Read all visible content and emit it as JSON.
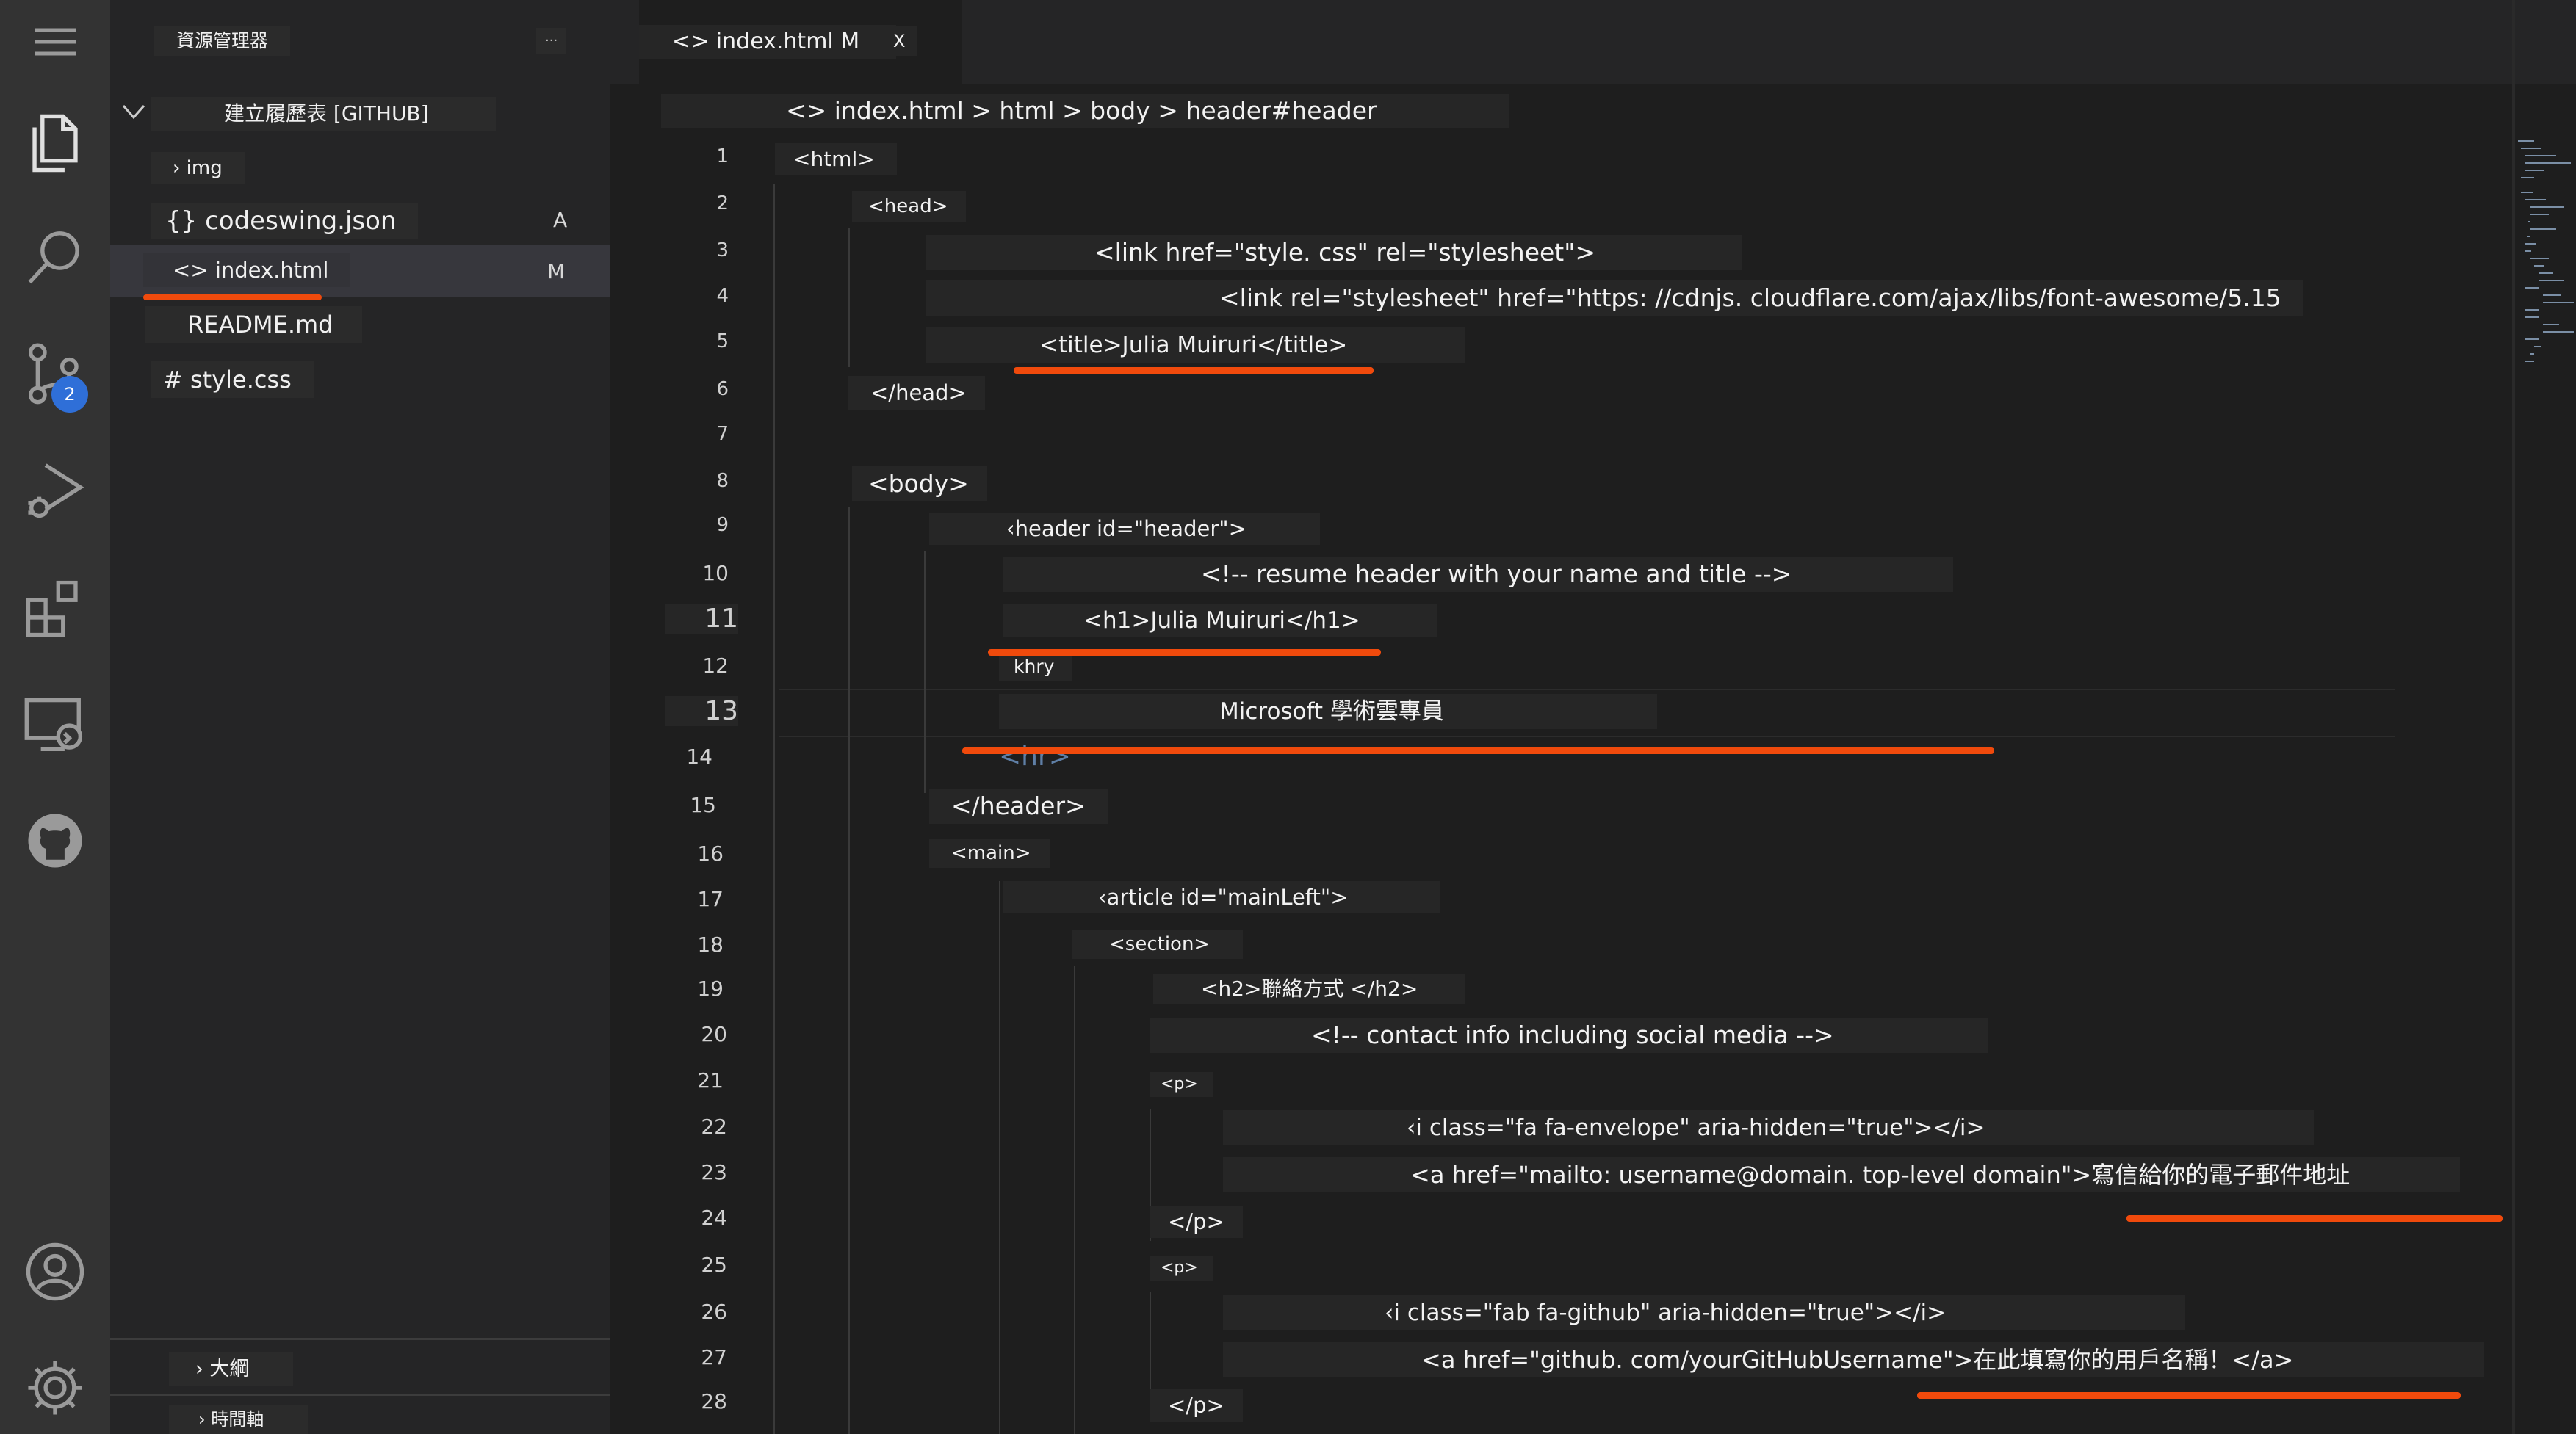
{
  "activity_bar": {
    "icons": [
      "menu-icon",
      "explorer-icon",
      "search-icon",
      "source-control-icon",
      "run-debug-icon",
      "extensions-icon",
      "remote-explorer-icon",
      "github-icon",
      "account-icon",
      "settings-gear-icon"
    ],
    "source_control_badge": "2"
  },
  "sidebar": {
    "title": "資源管理器",
    "more_actions": "···",
    "folder_name": "建立履歷表 [GITHUB]",
    "items": [
      {
        "label": "› img",
        "badge": ""
      },
      {
        "label": "{} codeswing.json",
        "badge": "A"
      },
      {
        "label": "<> index.html",
        "badge": "M"
      },
      {
        "label": "README.md",
        "badge": ""
      },
      {
        "label": "# style.css",
        "badge": ""
      }
    ],
    "outline_label": "› 大綱",
    "timeline_label": "› 時間軸"
  },
  "editor": {
    "tab_label": "<> index.html M",
    "tab_close": "X",
    "breadcrumb": "<> index.html > html > body > header#header",
    "lines": [
      {
        "num": "1",
        "text": "<html>"
      },
      {
        "num": "2",
        "text": "<head>"
      },
      {
        "num": "3",
        "text": "<link href=\"style. css\" rel=\"stylesheet\">"
      },
      {
        "num": "4",
        "text": "<link rel=\"stylesheet\" href=\"https: //cdnjs. cloudflare.com/ajax/libs/font-awesome/5.15"
      },
      {
        "num": "5",
        "text": "<title>Julia Muiruri</title>"
      },
      {
        "num": "6",
        "text": "</head>"
      },
      {
        "num": "7",
        "text": ""
      },
      {
        "num": "8",
        "text": "<body>"
      },
      {
        "num": "9",
        "text": "‹header id=\"header\">"
      },
      {
        "num": "10",
        "text": "<!-- resume header with your name and title -->"
      },
      {
        "num": "11",
        "text": "<h1>Julia Muiruri</h1>"
      },
      {
        "num": "12",
        "text": "khry"
      },
      {
        "num": "13",
        "text": "Microsoft 學術雲專員"
      },
      {
        "num": "14",
        "text": "<hr>"
      },
      {
        "num": "15",
        "text": "</header>"
      },
      {
        "num": "16",
        "text": "<main>"
      },
      {
        "num": "17",
        "text": "‹article id=\"mainLeft\">"
      },
      {
        "num": "18",
        "text": "<section>"
      },
      {
        "num": "19",
        "text": "<h2>聯絡方式 </h2>"
      },
      {
        "num": "20",
        "text": "<!-- contact info including social media -->"
      },
      {
        "num": "21",
        "text": "<p>"
      },
      {
        "num": "22",
        "text": "‹i class=\"fa fa-envelope\" aria-hidden=\"true\"></i>"
      },
      {
        "num": "23",
        "text": "<a href=\"mailto: username@domain. top-level domain\">寫信給你的電子郵件地址"
      },
      {
        "num": "24",
        "text": "</p>"
      },
      {
        "num": "25",
        "text": "<p>"
      },
      {
        "num": "26",
        "text": "‹i class=\"fab fa-github\" aria-hidden=\"true\"></i>"
      },
      {
        "num": "27",
        "text": "<a href=\"github. com/yourGitHubUsername\">在此填寫你的用戶名稱！</a>"
      },
      {
        "num": "28",
        "text": "</p>"
      }
    ]
  },
  "colors": {
    "highlight_underline": "#f04a0c",
    "badge_blue": "#2f6fd8"
  }
}
